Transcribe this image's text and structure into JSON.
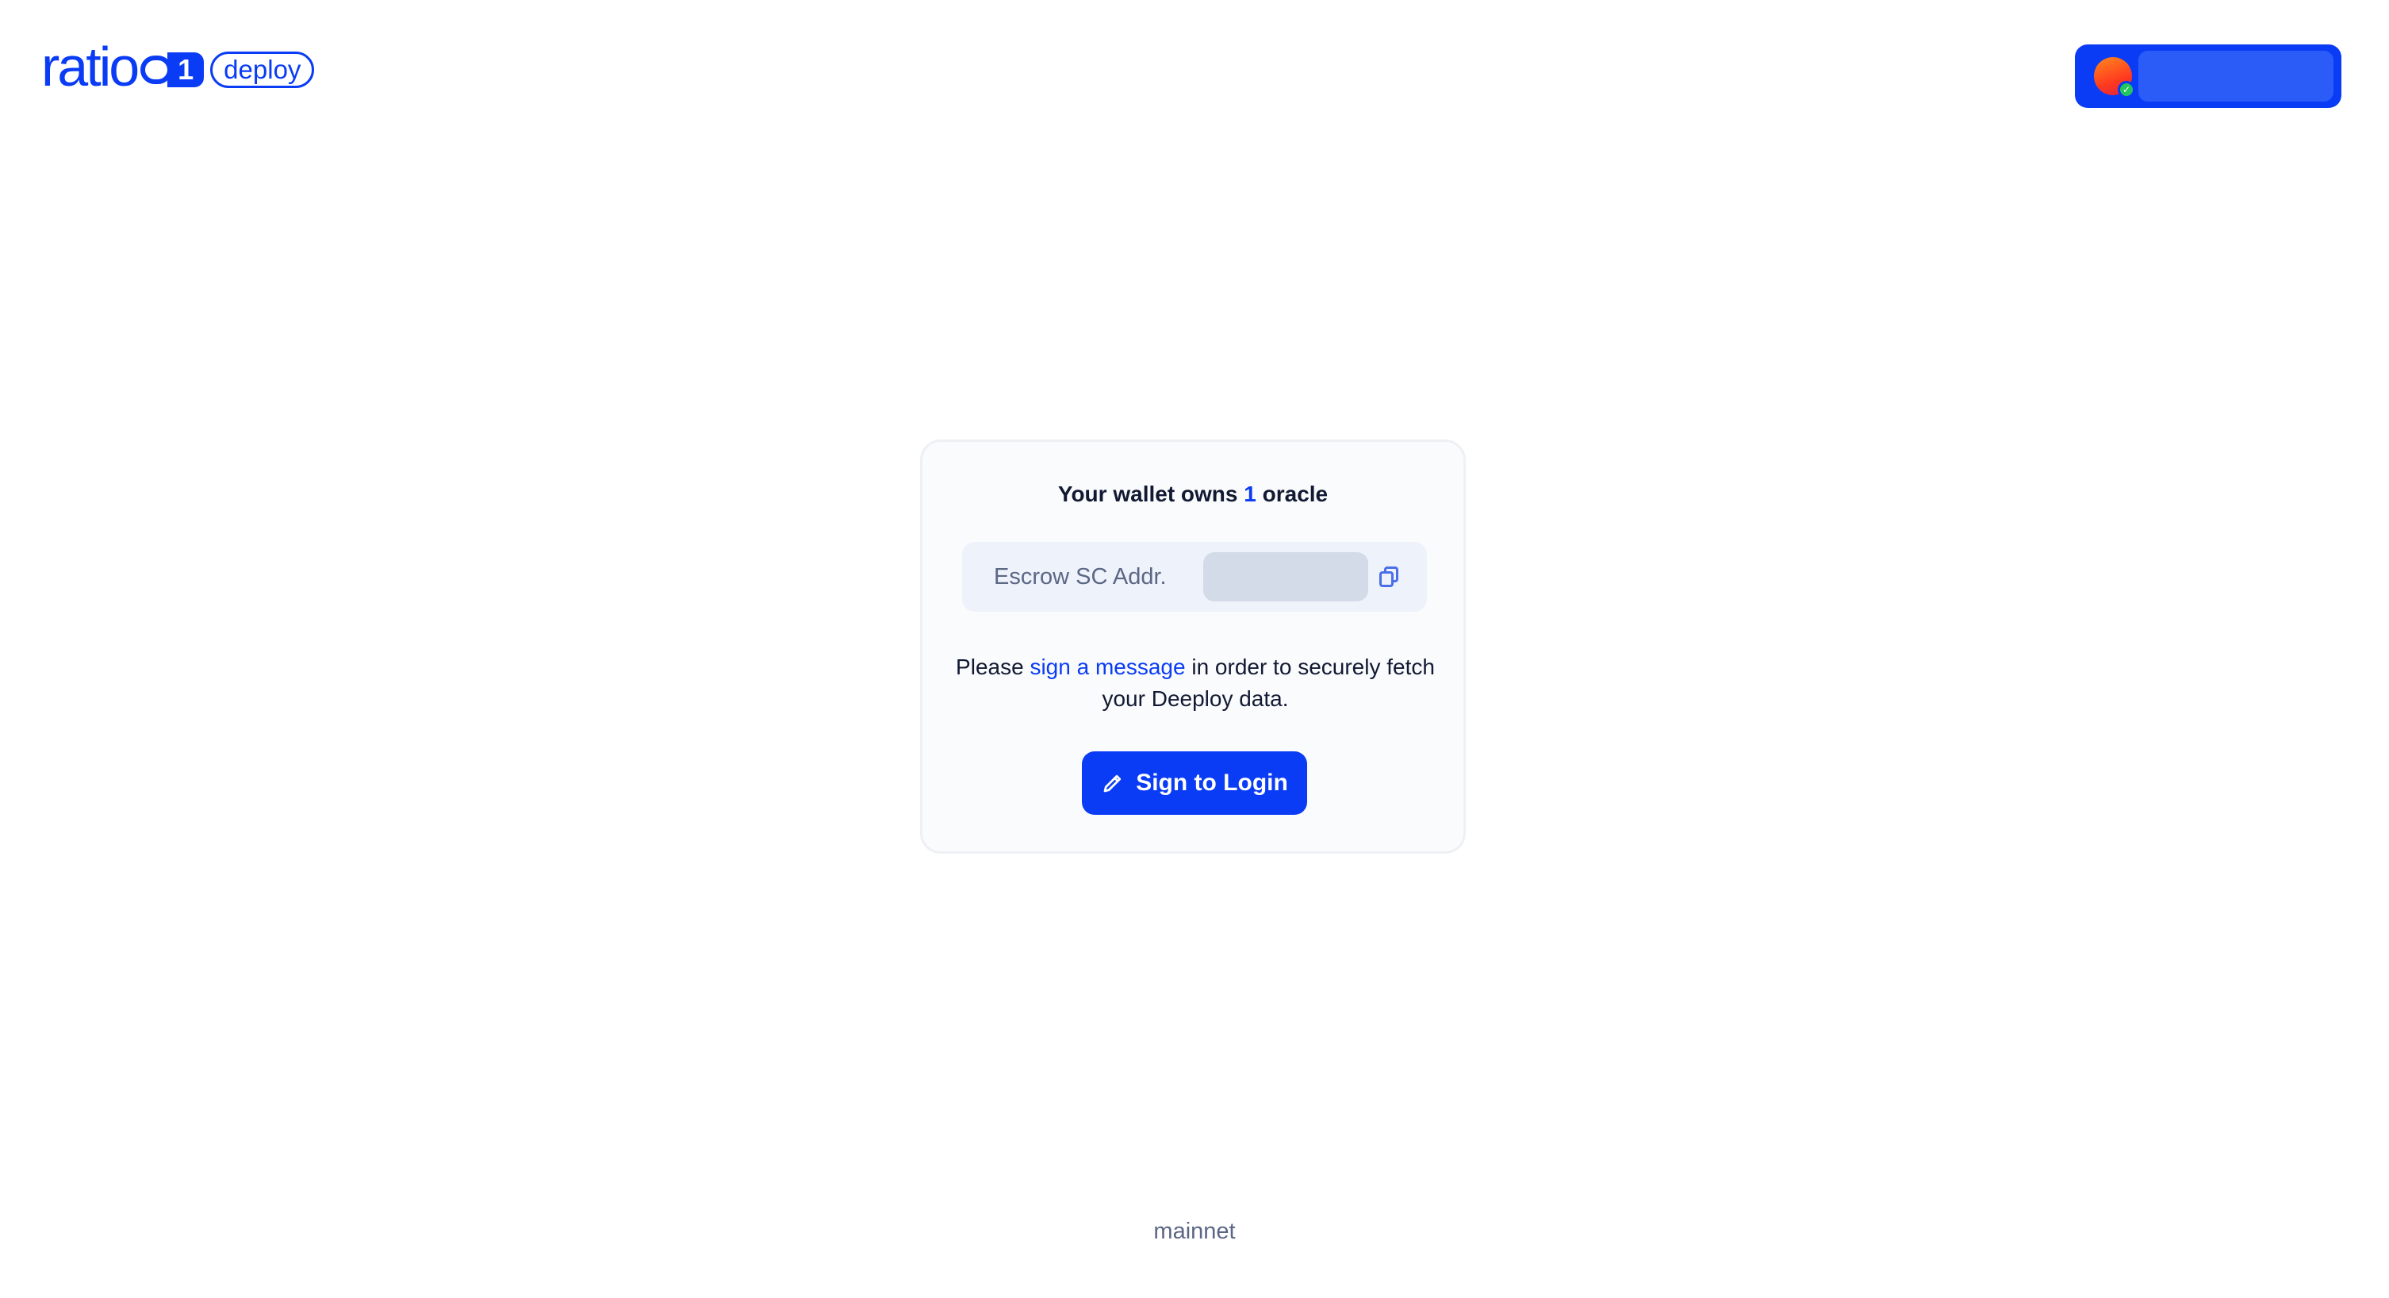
{
  "header": {
    "logo": {
      "word": "ratio",
      "one": "1",
      "badge": "deploy"
    },
    "wallet": {
      "avatar_icon": "wallet-avatar-icon",
      "address": ""
    }
  },
  "card": {
    "title_prefix": "Your wallet owns",
    "oracle_count": "1",
    "title_suffix": "oracle",
    "escrow_label": "Escrow SC Addr.",
    "escrow_value": "",
    "message_before": "Please",
    "message_link": "sign a message",
    "message_after": "in order to securely fetch your Deeploy data.",
    "sign_button_label": "Sign to Login"
  },
  "footer": {
    "network": "mainnet"
  },
  "colors": {
    "accent": "#0a3cf5",
    "muted": "#5c6785",
    "card_bg": "#fafbfc",
    "field_bg": "#eef2fb"
  }
}
